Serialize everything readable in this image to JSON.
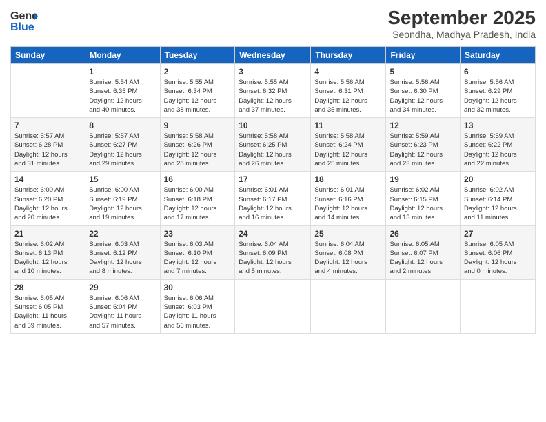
{
  "logo": {
    "line1": "General",
    "line2": "Blue"
  },
  "title": "September 2025",
  "subtitle": "Seondha, Madhya Pradesh, India",
  "days_header": [
    "Sunday",
    "Monday",
    "Tuesday",
    "Wednesday",
    "Thursday",
    "Friday",
    "Saturday"
  ],
  "weeks": [
    [
      {
        "num": "",
        "info": ""
      },
      {
        "num": "1",
        "info": "Sunrise: 5:54 AM\nSunset: 6:35 PM\nDaylight: 12 hours\nand 40 minutes."
      },
      {
        "num": "2",
        "info": "Sunrise: 5:55 AM\nSunset: 6:34 PM\nDaylight: 12 hours\nand 38 minutes."
      },
      {
        "num": "3",
        "info": "Sunrise: 5:55 AM\nSunset: 6:32 PM\nDaylight: 12 hours\nand 37 minutes."
      },
      {
        "num": "4",
        "info": "Sunrise: 5:56 AM\nSunset: 6:31 PM\nDaylight: 12 hours\nand 35 minutes."
      },
      {
        "num": "5",
        "info": "Sunrise: 5:56 AM\nSunset: 6:30 PM\nDaylight: 12 hours\nand 34 minutes."
      },
      {
        "num": "6",
        "info": "Sunrise: 5:56 AM\nSunset: 6:29 PM\nDaylight: 12 hours\nand 32 minutes."
      }
    ],
    [
      {
        "num": "7",
        "info": "Sunrise: 5:57 AM\nSunset: 6:28 PM\nDaylight: 12 hours\nand 31 minutes."
      },
      {
        "num": "8",
        "info": "Sunrise: 5:57 AM\nSunset: 6:27 PM\nDaylight: 12 hours\nand 29 minutes."
      },
      {
        "num": "9",
        "info": "Sunrise: 5:58 AM\nSunset: 6:26 PM\nDaylight: 12 hours\nand 28 minutes."
      },
      {
        "num": "10",
        "info": "Sunrise: 5:58 AM\nSunset: 6:25 PM\nDaylight: 12 hours\nand 26 minutes."
      },
      {
        "num": "11",
        "info": "Sunrise: 5:58 AM\nSunset: 6:24 PM\nDaylight: 12 hours\nand 25 minutes."
      },
      {
        "num": "12",
        "info": "Sunrise: 5:59 AM\nSunset: 6:23 PM\nDaylight: 12 hours\nand 23 minutes."
      },
      {
        "num": "13",
        "info": "Sunrise: 5:59 AM\nSunset: 6:22 PM\nDaylight: 12 hours\nand 22 minutes."
      }
    ],
    [
      {
        "num": "14",
        "info": "Sunrise: 6:00 AM\nSunset: 6:20 PM\nDaylight: 12 hours\nand 20 minutes."
      },
      {
        "num": "15",
        "info": "Sunrise: 6:00 AM\nSunset: 6:19 PM\nDaylight: 12 hours\nand 19 minutes."
      },
      {
        "num": "16",
        "info": "Sunrise: 6:00 AM\nSunset: 6:18 PM\nDaylight: 12 hours\nand 17 minutes."
      },
      {
        "num": "17",
        "info": "Sunrise: 6:01 AM\nSunset: 6:17 PM\nDaylight: 12 hours\nand 16 minutes."
      },
      {
        "num": "18",
        "info": "Sunrise: 6:01 AM\nSunset: 6:16 PM\nDaylight: 12 hours\nand 14 minutes."
      },
      {
        "num": "19",
        "info": "Sunrise: 6:02 AM\nSunset: 6:15 PM\nDaylight: 12 hours\nand 13 minutes."
      },
      {
        "num": "20",
        "info": "Sunrise: 6:02 AM\nSunset: 6:14 PM\nDaylight: 12 hours\nand 11 minutes."
      }
    ],
    [
      {
        "num": "21",
        "info": "Sunrise: 6:02 AM\nSunset: 6:13 PM\nDaylight: 12 hours\nand 10 minutes."
      },
      {
        "num": "22",
        "info": "Sunrise: 6:03 AM\nSunset: 6:12 PM\nDaylight: 12 hours\nand 8 minutes."
      },
      {
        "num": "23",
        "info": "Sunrise: 6:03 AM\nSunset: 6:10 PM\nDaylight: 12 hours\nand 7 minutes."
      },
      {
        "num": "24",
        "info": "Sunrise: 6:04 AM\nSunset: 6:09 PM\nDaylight: 12 hours\nand 5 minutes."
      },
      {
        "num": "25",
        "info": "Sunrise: 6:04 AM\nSunset: 6:08 PM\nDaylight: 12 hours\nand 4 minutes."
      },
      {
        "num": "26",
        "info": "Sunrise: 6:05 AM\nSunset: 6:07 PM\nDaylight: 12 hours\nand 2 minutes."
      },
      {
        "num": "27",
        "info": "Sunrise: 6:05 AM\nSunset: 6:06 PM\nDaylight: 12 hours\nand 0 minutes."
      }
    ],
    [
      {
        "num": "28",
        "info": "Sunrise: 6:05 AM\nSunset: 6:05 PM\nDaylight: 11 hours\nand 59 minutes."
      },
      {
        "num": "29",
        "info": "Sunrise: 6:06 AM\nSunset: 6:04 PM\nDaylight: 11 hours\nand 57 minutes."
      },
      {
        "num": "30",
        "info": "Sunrise: 6:06 AM\nSunset: 6:03 PM\nDaylight: 11 hours\nand 56 minutes."
      },
      {
        "num": "",
        "info": ""
      },
      {
        "num": "",
        "info": ""
      },
      {
        "num": "",
        "info": ""
      },
      {
        "num": "",
        "info": ""
      }
    ]
  ]
}
